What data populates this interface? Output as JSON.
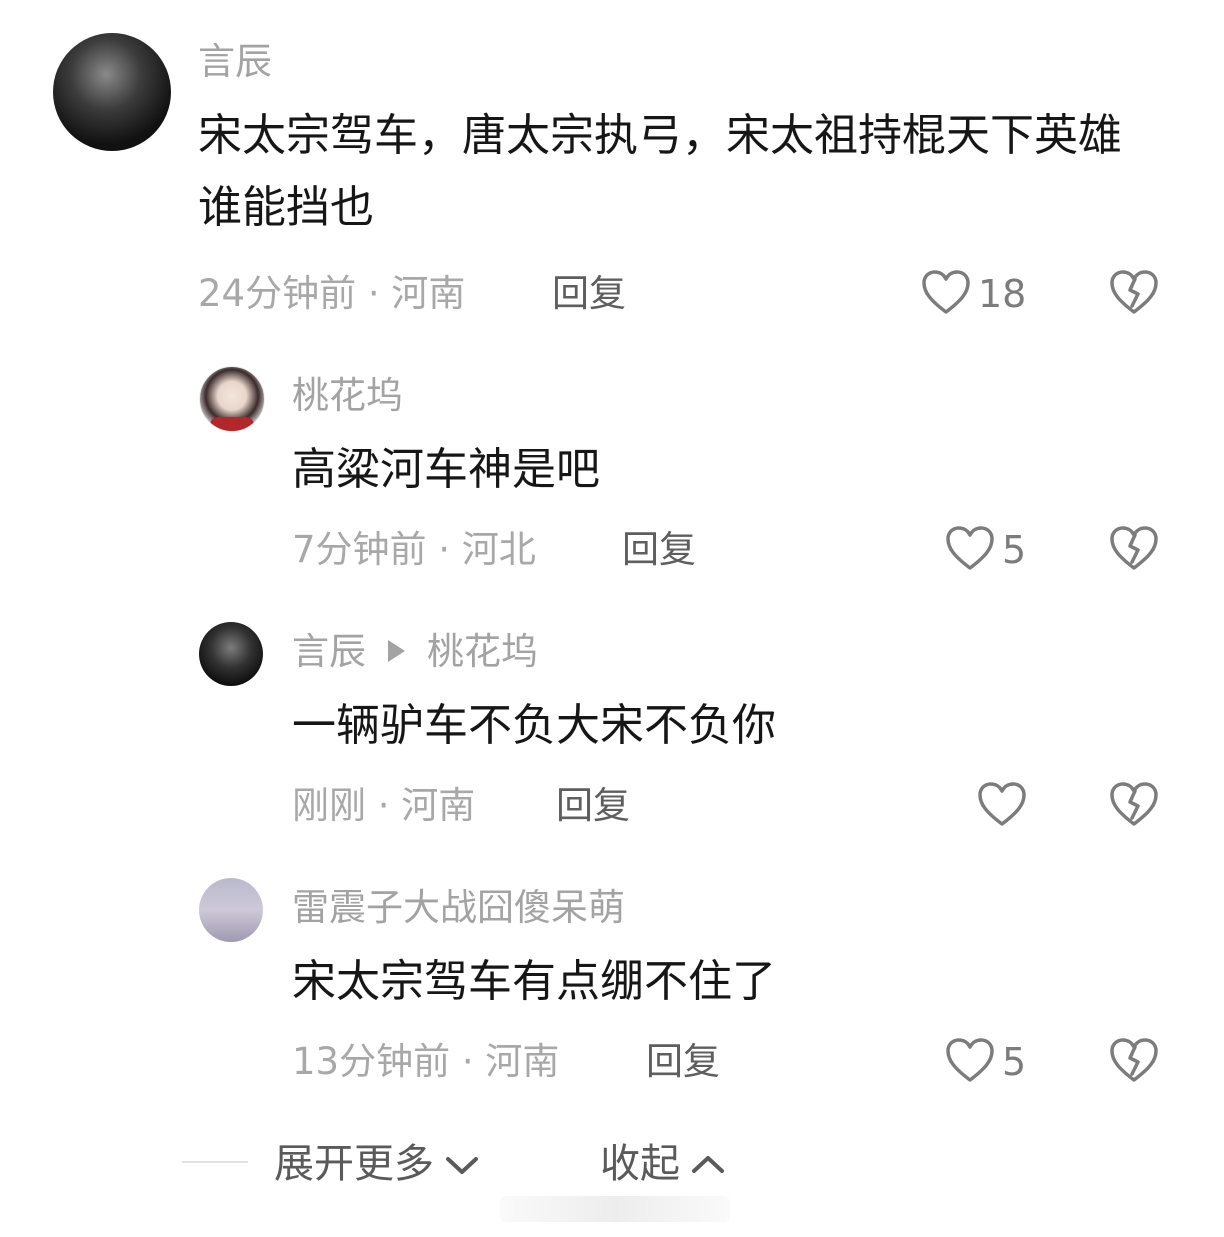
{
  "comments": [
    {
      "author": "言辰",
      "text": "宋太宗驾车，唐太宗执弓，宋太祖持棍天下英雄谁能挡也",
      "time_location": "24分钟前 · 河南",
      "reply_label": "回复",
      "likes": "18"
    },
    {
      "author": "桃花坞",
      "text": "高粱河车神是吧",
      "time_location": "7分钟前 · 河北",
      "reply_label": "回复",
      "likes": "5"
    },
    {
      "author": "言辰",
      "reply_to": "桃花坞",
      "text": "一辆驴车不负大宋不负你",
      "time_location": "刚刚 · 河南",
      "reply_label": "回复",
      "likes": ""
    },
    {
      "author": "雷震子大战囧傻呆萌",
      "text": "宋太宗驾车有点绷不住了",
      "time_location": "13分钟前 · 河南",
      "reply_label": "回复",
      "likes": "5"
    }
  ],
  "footer": {
    "expand_label": "展开更多",
    "collapse_label": "收起"
  },
  "icons": {
    "like": "heart-outline-icon",
    "dislike": "broken-heart-icon",
    "expand": "chevron-down-icon",
    "collapse": "chevron-up-icon"
  }
}
